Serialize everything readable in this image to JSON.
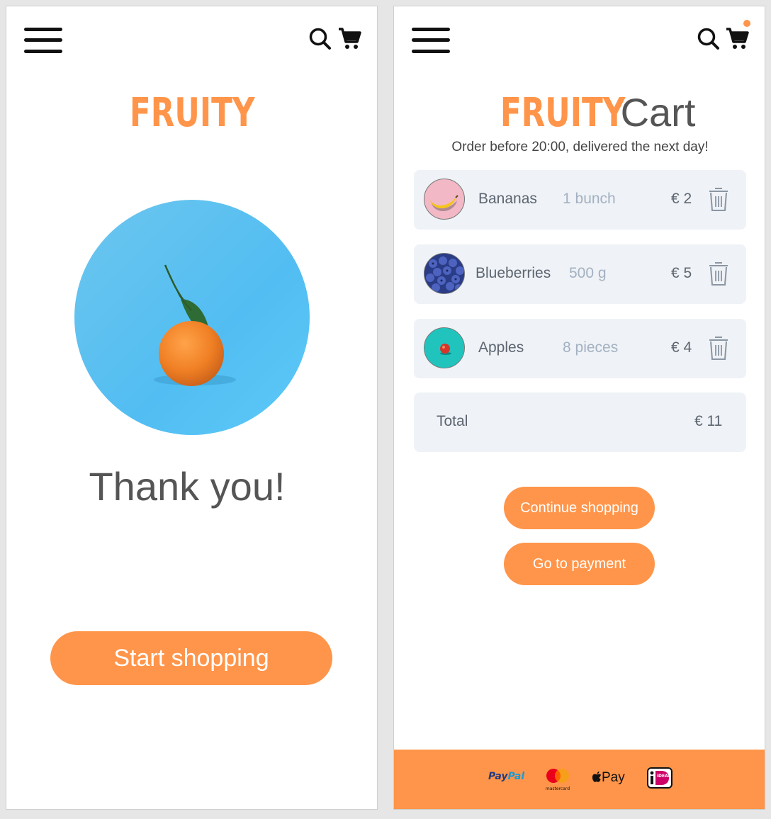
{
  "colors": {
    "accent": "#ff954a",
    "text_dark": "#555555",
    "row_bg": "#eff2f6",
    "muted": "#a3b1c2",
    "photo_bg": "#5cc1f0"
  },
  "left": {
    "brand": "FRUITY",
    "thanks": "Thank you!",
    "start_button": "Start shopping"
  },
  "right": {
    "brand": "FRUITY",
    "title_suffix": "Cart",
    "subtitle": "Order before 20:00, delivered the next day!",
    "items": [
      {
        "name": "Bananas",
        "quantity": "1 bunch",
        "price": "€ 2",
        "icon": "banana-thumbnail"
      },
      {
        "name": "Blueberries",
        "quantity": "500 g",
        "price": "€ 5",
        "icon": "blueberries-thumbnail"
      },
      {
        "name": "Apples",
        "quantity": "8 pieces",
        "price": "€ 4",
        "icon": "apple-thumbnail"
      }
    ],
    "total_label": "Total",
    "total_value": "€ 11",
    "continue_button": "Continue shopping",
    "payment_button": "Go to payment",
    "payment_methods": {
      "paypal_a": "Pay",
      "paypal_b": "Pal",
      "mastercard": "mastercard",
      "applepay": "Pay",
      "ideal": "iDEAL"
    }
  }
}
